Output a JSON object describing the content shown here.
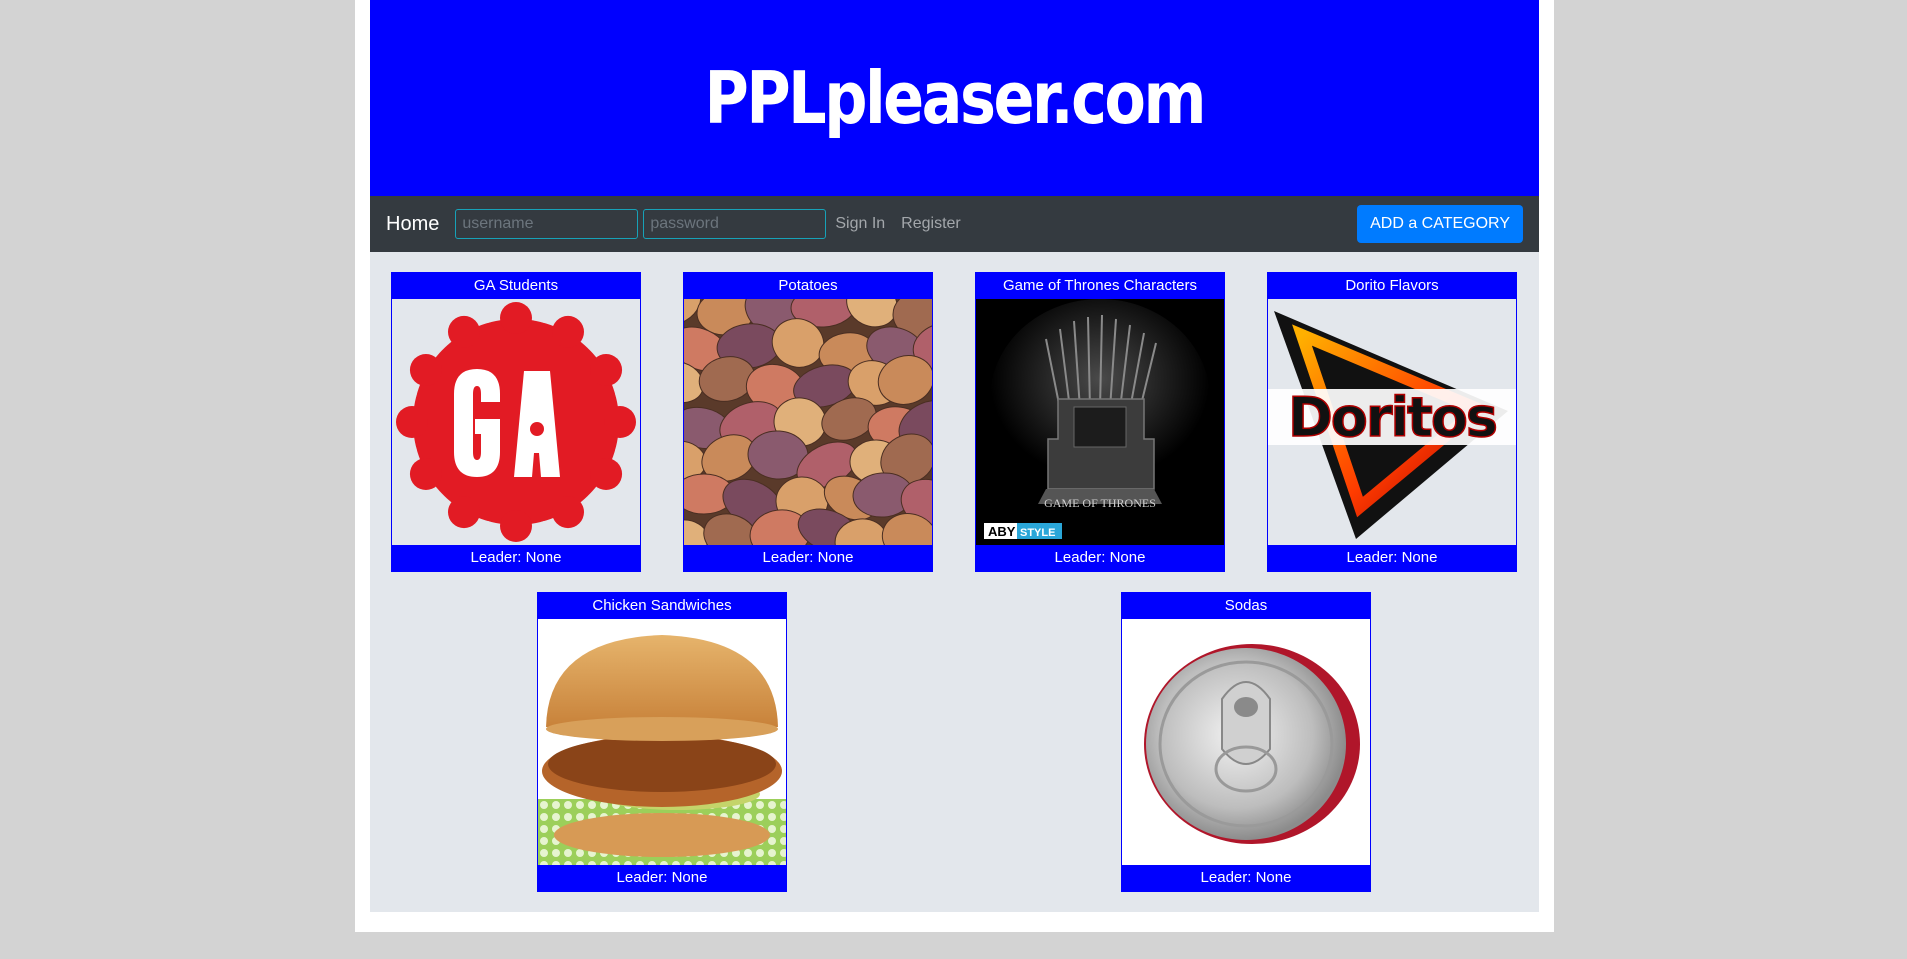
{
  "site": {
    "title": "PPLpleaser.com"
  },
  "nav": {
    "home_label": "Home",
    "username_placeholder": "username",
    "password_placeholder": "password",
    "signin_label": "Sign In",
    "register_label": "Register",
    "add_category_label": "ADD a CATEGORY"
  },
  "categories": [
    {
      "title": "GA Students",
      "leader": "Leader: None",
      "image_icon": "ga-logo-icon"
    },
    {
      "title": "Potatoes",
      "leader": "Leader: None",
      "image_icon": "potatoes-image"
    },
    {
      "title": "Game of Thrones Characters",
      "leader": "Leader: None",
      "image_icon": "iron-throne-image",
      "image_text": {
        "logo": "GAME OF THRONES",
        "badge_a": "ABY",
        "badge_b": "STYLE"
      }
    },
    {
      "title": "Dorito Flavors",
      "leader": "Leader: None",
      "image_icon": "doritos-logo-icon",
      "image_text": {
        "logo": "Doritos"
      }
    },
    {
      "title": "Chicken Sandwiches",
      "leader": "Leader: None",
      "image_icon": "chicken-sandwich-image"
    },
    {
      "title": "Sodas",
      "leader": "Leader: None",
      "image_icon": "soda-can-image"
    }
  ],
  "colors": {
    "banner": "#0000ff",
    "navbar": "#343a40",
    "accent_button": "#007bff",
    "card_header": "#0000ff",
    "content_background": "#e3e7ec"
  }
}
